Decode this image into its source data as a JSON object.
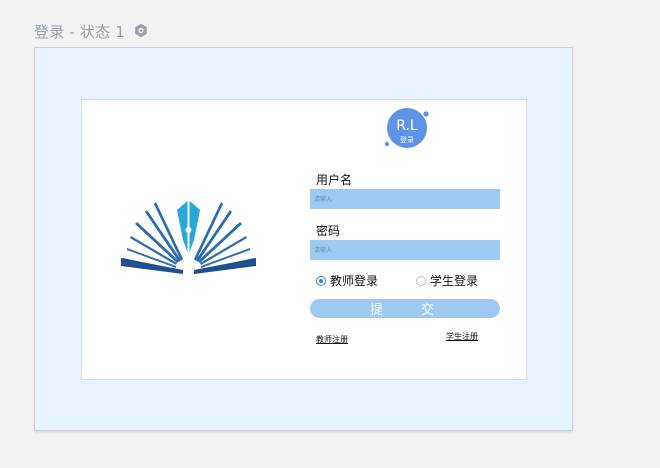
{
  "panel": {
    "title": "登录 - 状态 1",
    "settings_icon": "gear-icon"
  },
  "login": {
    "brand_logo_text": "R.L",
    "brand_logo_subtext": "登录",
    "username_label": "用户名",
    "username_placeholder": "请输入",
    "password_label": "密码",
    "password_placeholder": "请输入",
    "role_options": [
      {
        "label": "教师登录",
        "selected": true
      },
      {
        "label": "学生登录",
        "selected": false
      }
    ],
    "submit_label": "提交",
    "teacher_register_label": "教师注册",
    "student_register_label": "学生注册"
  },
  "colors": {
    "page_bg": "#f2f2f2",
    "frame_bg": "#e6f2ff",
    "card_bg": "#ffffff",
    "input_bg": "#9ccaf3",
    "logo_blue": "#2b6cae",
    "logo_teal": "#27a8d8",
    "rl_blue": "#5e93e6"
  }
}
